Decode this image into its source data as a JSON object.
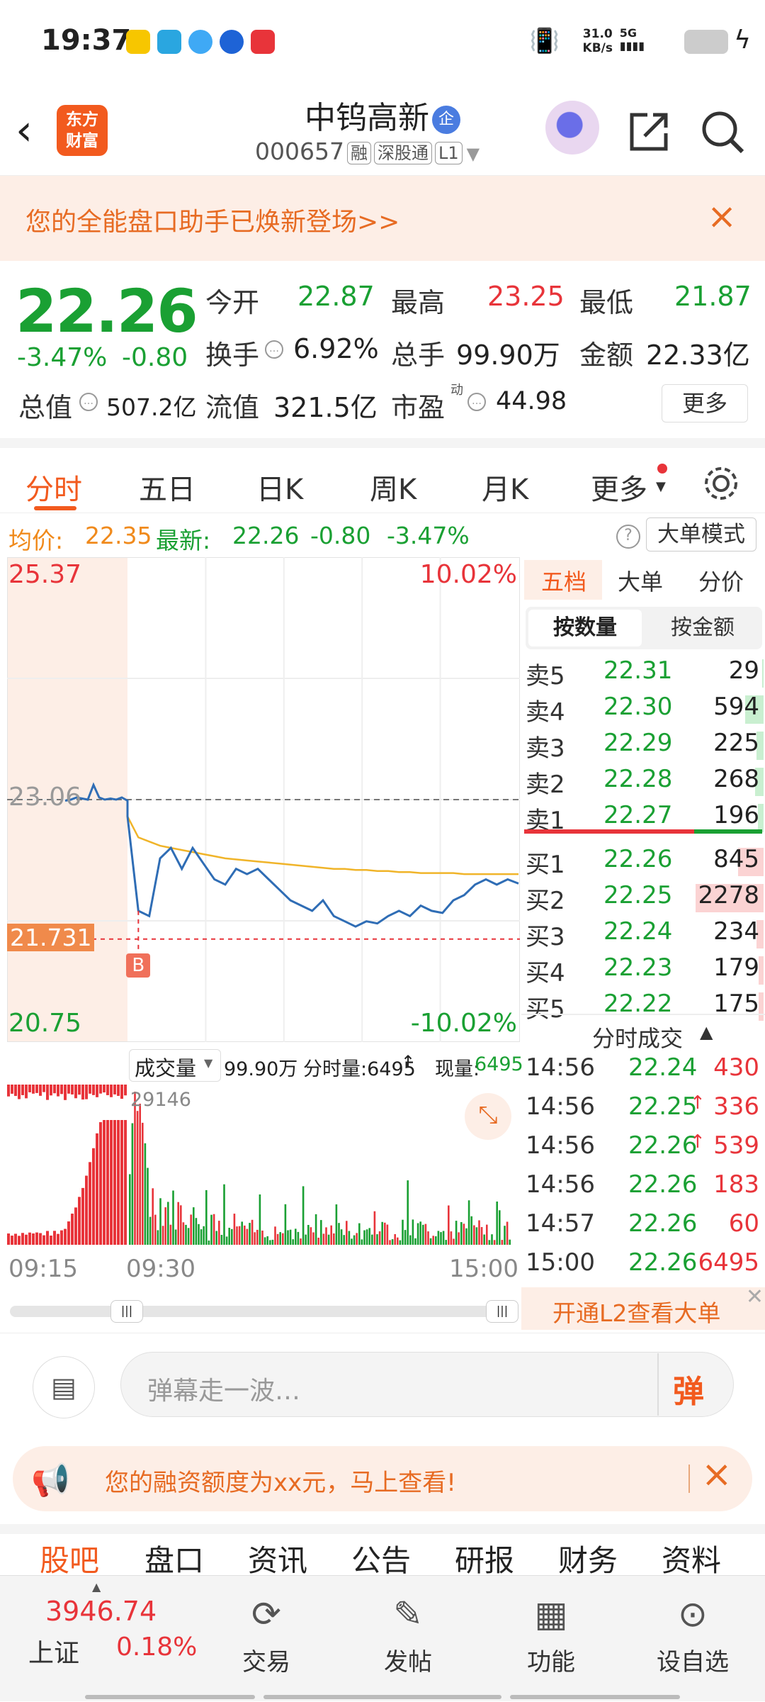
{
  "status": {
    "time": "19:37",
    "net_speed": "31.0",
    "net_unit": "KB/s",
    "signal": "5G"
  },
  "header": {
    "back": "‹",
    "logo_l1": "东方",
    "logo_l2": "财富",
    "name": "中钨高新",
    "name_badge": "企",
    "code": "000657",
    "tags": [
      "融",
      "深股通",
      "L1"
    ]
  },
  "banner": {
    "text": "您的全能盘口助手已焕新登场>>",
    "close": "×"
  },
  "quote": {
    "price": "22.26",
    "change_pct": "-3.47%",
    "change": "-0.80",
    "open_label": "今开",
    "open": "22.87",
    "high_label": "最高",
    "high": "23.25",
    "low_label": "最低",
    "low": "21.87",
    "turnover_label": "换手",
    "turnover": "6.92%",
    "volume_label": "总手",
    "volume": "99.90万",
    "amount_label": "金额",
    "amount": "22.33亿",
    "mcap_label": "总值",
    "mcap": "507.2亿",
    "float_label": "流值",
    "float": "321.5亿",
    "pe_label": "市盈",
    "pe_sup": "动",
    "pe": "44.98",
    "more": "更多"
  },
  "tabs": [
    "分时",
    "五日",
    "日K",
    "周K",
    "月K",
    "更多"
  ],
  "avgline": {
    "avg_label": "均价:",
    "avg": "22.35",
    "last_label": "最新:",
    "last": "22.26",
    "chg": "-0.80",
    "pct": "-3.47%",
    "mode": "大单模式"
  },
  "chart": {
    "top_price": "25.37",
    "top_pct": "10.02%",
    "mid_price": "23.06",
    "bot_price": "20.75",
    "bot_pct": "-10.02%",
    "cursor_price": "21.731",
    "marker": "B"
  },
  "chart_data": {
    "type": "line",
    "ylim": [
      20.75,
      25.37
    ],
    "prev_close": 23.06,
    "series": [
      {
        "values": [
          23.05,
          23.06,
          23.08,
          23.07,
          23.06,
          23.2,
          23.08,
          23.06,
          23.07,
          23.06,
          23.08,
          23.05,
          22.9,
          22.0,
          21.95,
          22.5,
          22.6,
          22.4,
          22.6,
          22.45,
          22.3,
          22.25,
          22.4,
          22.35,
          22.4,
          22.3,
          22.2,
          22.1,
          22.05,
          22.0,
          22.1,
          21.95,
          21.9,
          21.85,
          21.9,
          21.88,
          21.95,
          22.0,
          21.95,
          22.05,
          22.0,
          21.98,
          22.1,
          22.15,
          22.25,
          22.3,
          22.25,
          22.3,
          22.26
        ]
      },
      {
        "values": [
          23.06,
          23.06,
          23.06,
          23.06,
          23.06,
          23.06,
          23.06,
          23.06,
          23.06,
          23.06,
          23.06,
          23.06,
          22.9,
          22.7,
          22.66,
          22.62,
          22.6,
          22.58,
          22.56,
          22.54,
          22.52,
          22.5,
          22.49,
          22.48,
          22.47,
          22.46,
          22.45,
          22.44,
          22.43,
          22.42,
          22.41,
          22.4,
          22.4,
          22.39,
          22.39,
          22.38,
          22.38,
          22.37,
          22.37,
          22.36,
          22.36,
          22.36,
          22.36,
          22.35,
          22.35,
          22.35,
          22.35,
          22.35,
          22.35
        ]
      }
    ]
  },
  "book": {
    "tabs": [
      "五档",
      "大单",
      "分价"
    ],
    "subtabs": [
      "按数量",
      "按金额"
    ],
    "asks": [
      {
        "l": "卖5",
        "p": "22.31",
        "v": "29",
        "w": 0.02
      },
      {
        "l": "卖4",
        "p": "22.30",
        "v": "594",
        "w": 0.22
      },
      {
        "l": "卖3",
        "p": "22.29",
        "v": "225",
        "w": 0.08
      },
      {
        "l": "卖2",
        "p": "22.28",
        "v": "268",
        "w": 0.1
      },
      {
        "l": "卖1",
        "p": "22.27",
        "v": "196",
        "w": 0.07
      }
    ],
    "bids": [
      {
        "l": "买1",
        "p": "22.26",
        "v": "845",
        "w": 0.3
      },
      {
        "l": "买2",
        "p": "22.25",
        "v": "2278",
        "w": 0.8
      },
      {
        "l": "买3",
        "p": "22.24",
        "v": "234",
        "w": 0.08
      },
      {
        "l": "买4",
        "p": "22.23",
        "v": "179",
        "w": 0.06
      },
      {
        "l": "买5",
        "p": "22.22",
        "v": "175",
        "w": 0.06
      }
    ],
    "ticks_title": "分时成交",
    "ticks": [
      {
        "t": "14:56",
        "p": "22.24",
        "v": "430",
        "up": false
      },
      {
        "t": "14:56",
        "p": "22.25",
        "v": "336",
        "up": true
      },
      {
        "t": "14:56",
        "p": "22.26",
        "v": "539",
        "up": true
      },
      {
        "t": "14:56",
        "p": "22.26",
        "v": "183",
        "up": false
      },
      {
        "t": "14:57",
        "p": "22.26",
        "v": "60",
        "up": false
      },
      {
        "t": "15:00",
        "p": "22.26",
        "v": "6495",
        "up": false
      }
    ],
    "l2": "开通L2查看大单"
  },
  "volume": {
    "label": "成交量",
    "total": "99.90万",
    "tick_label": "分时量:6495",
    "cur_label": "现量:",
    "cur": "6495",
    "peak": "29146"
  },
  "time_axis": [
    "09:15",
    "09:30",
    "15:00"
  ],
  "comment": {
    "placeholder": "弹幕走一波…",
    "send": "弹"
  },
  "ad": {
    "text": "您的融资额度为xx元，马上查看!",
    "close": "×"
  },
  "bottom_tabs": [
    "股吧",
    "盘口",
    "资讯",
    "公告",
    "研报",
    "财务",
    "资料"
  ],
  "nav": {
    "index_value": "3946.74",
    "index_name": "上证",
    "index_pct": "0.18%",
    "items": [
      "交易",
      "发帖",
      "功能",
      "设自选"
    ]
  },
  "colors": {
    "up": "#e8343a",
    "down": "#1aa033",
    "accent": "#f25a1e",
    "avg": "#f0b429",
    "price_line": "#2f6db5"
  }
}
